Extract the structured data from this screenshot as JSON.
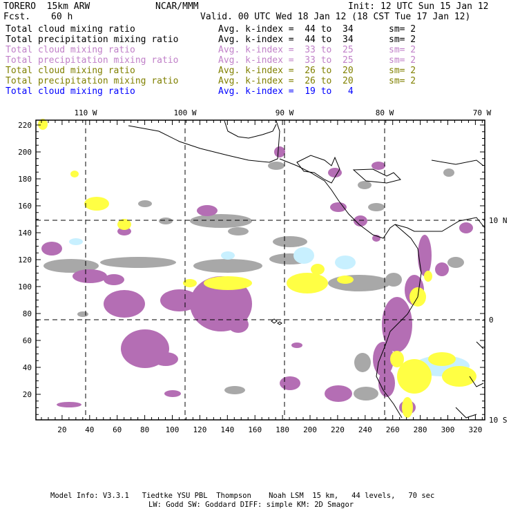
{
  "header": {
    "model": "TORERO  15km ARW",
    "org": "NCAR/MMM",
    "init": "Init: 12 UTC Sun 15 Jan 12",
    "fcst_label": "Fcst.",
    "fcst_value": "60 h",
    "valid": "Valid. 00 UTC Wed 18 Jan 12 (18 CST Tue 17 Jan 12)"
  },
  "legend": [
    {
      "field": "Total cloud mixing ratio",
      "index": "Avg. k-index =  44 to  34",
      "sm": "sm= 2",
      "color": "#000000"
    },
    {
      "field": "Total precipitation mixing ratio",
      "index": "Avg. k-index =  44 to  34",
      "sm": "sm= 2",
      "color": "#000000"
    },
    {
      "field": "Total cloud mixing ratio",
      "index": "Avg. k-index =  33 to  25",
      "sm": "sm= 2",
      "color": "#c080c8"
    },
    {
      "field": "Total precipitation mixing ratio",
      "index": "Avg. k-index =  33 to  25",
      "sm": "sm= 2",
      "color": "#c080c8"
    },
    {
      "field": "Total cloud mixing ratio",
      "index": "Avg. k-index =  26 to  20",
      "sm": "sm= 2",
      "color": "#808000"
    },
    {
      "field": "Total precipitation mixing ratio",
      "index": "Avg. k-index =  26 to  20",
      "sm": "sm= 2",
      "color": "#808000"
    },
    {
      "field": "Total cloud mixing ratio",
      "index": "Avg. k-index =  19 to   4",
      "sm": "",
      "color": "#0000ff"
    }
  ],
  "axes": {
    "lon_labels": [
      "110 W",
      "100 W",
      "90 W",
      "80 W",
      "70 W"
    ],
    "lat_labels": [
      "10 N",
      "0",
      "10 S"
    ],
    "x_ticks": [
      "20",
      "40",
      "60",
      "80",
      "100",
      "120",
      "140",
      "160",
      "180",
      "200",
      "220",
      "240",
      "260",
      "280",
      "300",
      "320"
    ],
    "y_ticks": [
      "20",
      "40",
      "60",
      "80",
      "100",
      "120",
      "140",
      "160",
      "180",
      "200",
      "220"
    ]
  },
  "footer": {
    "line1": "Model Info: V3.3.1   Tiedtke YSU PBL  Thompson    Noah LSM  15 km,   44 levels,   70 sec",
    "line2": "LW: Godd SW: Goddard DIFF: simple KM: 2D Smagor"
  },
  "colors": {
    "gray": "#a8a8a8",
    "purple": "#b46eb4",
    "yellow": "#ffff44",
    "lightblue": "#c8f0ff"
  }
}
